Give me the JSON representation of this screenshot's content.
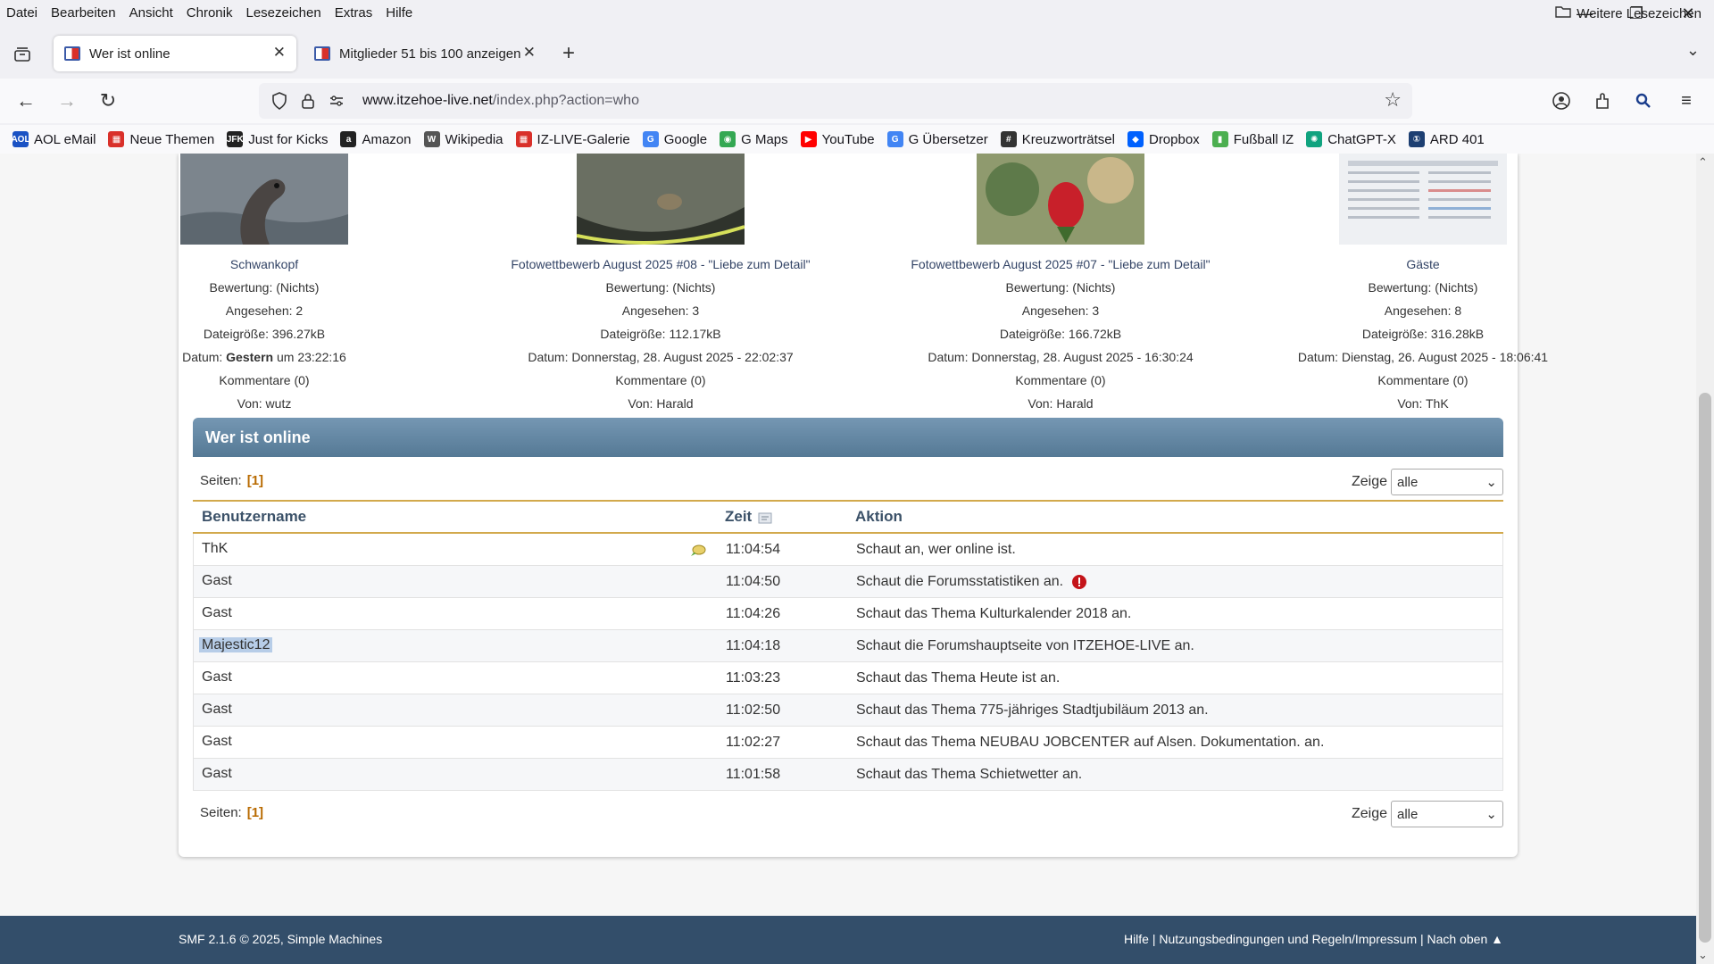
{
  "menu": [
    "Datei",
    "Bearbeiten",
    "Ansicht",
    "Chronik",
    "Lesezeichen",
    "Extras",
    "Hilfe"
  ],
  "tabs": {
    "active": "Wer ist online",
    "inactive": "Mitglieder 51 bis 100 anzeigen"
  },
  "url": {
    "domain": "www.itzehoe-live.net",
    "path": "/index.php?action=who"
  },
  "bookmarks": [
    {
      "label": "AOL eMail",
      "color": "#1a52c4",
      "glyph": "AOL"
    },
    {
      "label": "Neue Themen",
      "color": "#d9302a",
      "glyph": "▦"
    },
    {
      "label": "Just for Kicks",
      "color": "#222222",
      "glyph": "JFK"
    },
    {
      "label": "Amazon",
      "color": "#222222",
      "glyph": "a"
    },
    {
      "label": "Wikipedia",
      "color": "#555555",
      "glyph": "W"
    },
    {
      "label": "IZ-LIVE-Galerie",
      "color": "#d9302a",
      "glyph": "▦"
    },
    {
      "label": "Google",
      "color": "#4285f4",
      "glyph": "G"
    },
    {
      "label": "G Maps",
      "color": "#34a853",
      "glyph": "◉"
    },
    {
      "label": "YouTube",
      "color": "#ff0000",
      "glyph": "▶"
    },
    {
      "label": "G Übersetzer",
      "color": "#4285f4",
      "glyph": "G"
    },
    {
      "label": "Kreuzworträtsel",
      "color": "#333333",
      "glyph": "#"
    },
    {
      "label": "Dropbox",
      "color": "#0061fe",
      "glyph": "◆"
    },
    {
      "label": "Fußball IZ",
      "color": "#4caf50",
      "glyph": "▮"
    },
    {
      "label": "ChatGPT-X",
      "color": "#10a37f",
      "glyph": "✺"
    },
    {
      "label": "ARD 401",
      "color": "#1d3f72",
      "glyph": "①"
    }
  ],
  "bookmarks_more": "Weitere Lesezeichen",
  "gallery": [
    {
      "title": "Schwankopf",
      "rating": "Bewertung: (Nichts)",
      "views": "Angesehen: 2",
      "size": "Dateigröße: 396.27kB",
      "date_prefix": "Datum: ",
      "date_bold": "Gestern",
      "date_suffix": " um 23:22:16",
      "comments": "Kommentare (0)",
      "by": "Von: wutz"
    },
    {
      "title": "Fotowettbewerb August 2025 #08 - \"Liebe zum Detail\"",
      "rating": "Bewertung: (Nichts)",
      "views": "Angesehen: 3",
      "size": "Dateigröße: 112.17kB",
      "date_prefix": "Datum: Donnerstag, 28. August 2025 - 22:02:37",
      "date_bold": "",
      "date_suffix": "",
      "comments": "Kommentare (0)",
      "by": "Von: Harald"
    },
    {
      "title": "Fotowettbewerb August 2025 #07 - \"Liebe zum Detail\"",
      "rating": "Bewertung: (Nichts)",
      "views": "Angesehen: 3",
      "size": "Dateigröße: 166.72kB",
      "date_prefix": "Datum: Donnerstag, 28. August 2025 - 16:30:24",
      "date_bold": "",
      "date_suffix": "",
      "comments": "Kommentare (0)",
      "by": "Von: Harald"
    },
    {
      "title": "Gäste",
      "rating": "Bewertung: (Nichts)",
      "views": "Angesehen: 8",
      "size": "Dateigröße: 316.28kB",
      "date_prefix": "Datum: Dienstag, 26. August 2025 - 18:06:41",
      "date_bold": "",
      "date_suffix": "",
      "comments": "Kommentare (0)",
      "by": "Von: ThK"
    }
  ],
  "section_title": "Wer ist online",
  "pages_label": "Seiten:",
  "pages_value": "[1]",
  "show_label": "Zeige",
  "show_value": "alle",
  "table": {
    "headers": [
      "Benutzername",
      "Zeit",
      "Aktion"
    ],
    "rows": [
      {
        "user": "ThK",
        "time": "11:04:54",
        "action": "Schaut an, wer online ist."
      },
      {
        "user": "Gast",
        "time": "11:04:50",
        "action": "Schaut die Forumsstatistiken an."
      },
      {
        "user": "Gast",
        "time": "11:04:26",
        "action": "Schaut das Thema Kulturkalender 2018 an."
      },
      {
        "user": "Majestic12",
        "time": "11:04:18",
        "action": "Schaut die Forumshauptseite von ITZEHOE-LIVE an."
      },
      {
        "user": "Gast",
        "time": "11:03:23",
        "action": "Schaut das Thema Heute ist an."
      },
      {
        "user": "Gast",
        "time": "11:02:50",
        "action": "Schaut das Thema 775-jähriges Stadtjubiläum 2013 an."
      },
      {
        "user": "Gast",
        "time": "11:02:27",
        "action": "Schaut das Thema NEUBAU JOBCENTER auf Alsen. Dokumentation. an."
      },
      {
        "user": "Gast",
        "time": "11:01:58",
        "action": "Schaut das Thema Schietwetter an."
      }
    ]
  },
  "footer": {
    "left": "SMF 2.1.6 © 2025, Simple Machines",
    "right": "Hilfe | Nutzungsbedingungen und Regeln/Impressum | Nach oben ▲"
  }
}
